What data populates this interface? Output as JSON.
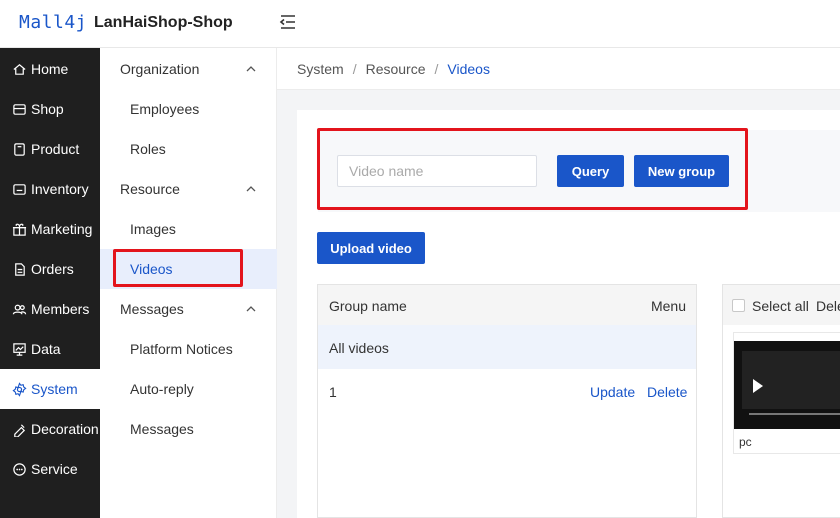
{
  "app": {
    "logo": "Mall4j",
    "brand": "LanHaiShop-Shop"
  },
  "sidebar": {
    "items": [
      {
        "label": "Home",
        "icon": "home-icon"
      },
      {
        "label": "Shop",
        "icon": "shop-icon"
      },
      {
        "label": "Product",
        "icon": "product-icon"
      },
      {
        "label": "Inventory",
        "icon": "inventory-icon"
      },
      {
        "label": "Marketing",
        "icon": "gift-icon"
      },
      {
        "label": "Orders",
        "icon": "orders-icon"
      },
      {
        "label": "Members",
        "icon": "members-icon"
      },
      {
        "label": "Data",
        "icon": "data-icon"
      },
      {
        "label": "System",
        "icon": "gear-icon",
        "active": true
      },
      {
        "label": "Decoration",
        "icon": "decoration-icon"
      },
      {
        "label": "Service",
        "icon": "chat-icon"
      }
    ]
  },
  "submenu": {
    "organization": "Organization",
    "employees": "Employees",
    "roles": "Roles",
    "resource": "Resource",
    "images": "Images",
    "videos": "Videos",
    "messages_group": "Messages",
    "platform_notices": "Platform Notices",
    "auto_reply": "Auto-reply",
    "messages": "Messages"
  },
  "breadcrumb": {
    "a": "System",
    "b": "Resource",
    "c": "Videos",
    "sep": "/"
  },
  "search": {
    "placeholder": "Video name",
    "query_label": "Query",
    "new_group_label": "New group"
  },
  "upload_label": "Upload video",
  "groups": {
    "header_name": "Group name",
    "header_menu": "Menu",
    "all_label": "All videos",
    "rows": [
      {
        "name": "1",
        "update": "Update",
        "delete": "Delete"
      }
    ]
  },
  "videos": {
    "select_all": "Select all",
    "delete_label": "Dele",
    "items": [
      {
        "name": "pc"
      }
    ]
  },
  "colors": {
    "accent": "#1a56c9",
    "highlight_box": "#e3141c",
    "sidebar_bg": "#1f1f1f"
  }
}
